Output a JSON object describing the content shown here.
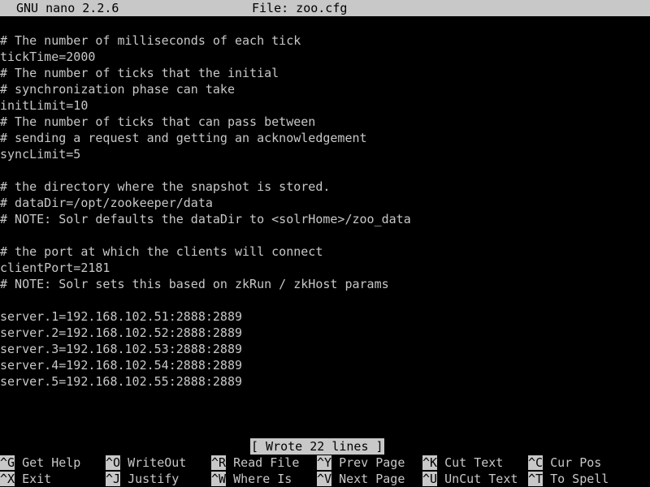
{
  "titlebar": {
    "version": "GNU nano 2.2.6",
    "file_label": "File: zoo.cfg"
  },
  "editor": {
    "lines": [
      "# The number of milliseconds of each tick",
      "tickTime=2000",
      "# The number of ticks that the initial",
      "# synchronization phase can take",
      "initLimit=10",
      "# The number of ticks that can pass between",
      "# sending a request and getting an acknowledgement",
      "syncLimit=5",
      "",
      "# the directory where the snapshot is stored.",
      "# dataDir=/opt/zookeeper/data",
      "# NOTE: Solr defaults the dataDir to <solrHome>/zoo_data",
      "",
      "# the port at which the clients will connect",
      "clientPort=2181",
      "# NOTE: Solr sets this based on zkRun / zkHost params",
      "",
      "server.1=192.168.102.51:2888:2889",
      "server.2=192.168.102.52:2888:2889",
      "server.3=192.168.102.53:2888:2889",
      "server.4=192.168.102.54:2888:2889",
      "server.5=192.168.102.55:2888:2889",
      "",
      "",
      ""
    ]
  },
  "status": {
    "message": "[ Wrote 22 lines ]"
  },
  "shortcuts": {
    "row1": [
      {
        "key": "^G",
        "label": "Get Help"
      },
      {
        "key": "^O",
        "label": "WriteOut"
      },
      {
        "key": "^R",
        "label": "Read File"
      },
      {
        "key": "^Y",
        "label": "Prev Page"
      },
      {
        "key": "^K",
        "label": "Cut Text"
      },
      {
        "key": "^C",
        "label": "Cur Pos"
      }
    ],
    "row2": [
      {
        "key": "^X",
        "label": "Exit"
      },
      {
        "key": "^J",
        "label": "Justify"
      },
      {
        "key": "^W",
        "label": "Where Is"
      },
      {
        "key": "^V",
        "label": "Next Page"
      },
      {
        "key": "^U",
        "label": "UnCut Text"
      },
      {
        "key": "^T",
        "label": "To Spell"
      }
    ]
  },
  "colors": {
    "background": "#000000",
    "foreground": "#c8c8c8",
    "inverse_bg": "#c8c8c8",
    "inverse_fg": "#000000"
  }
}
